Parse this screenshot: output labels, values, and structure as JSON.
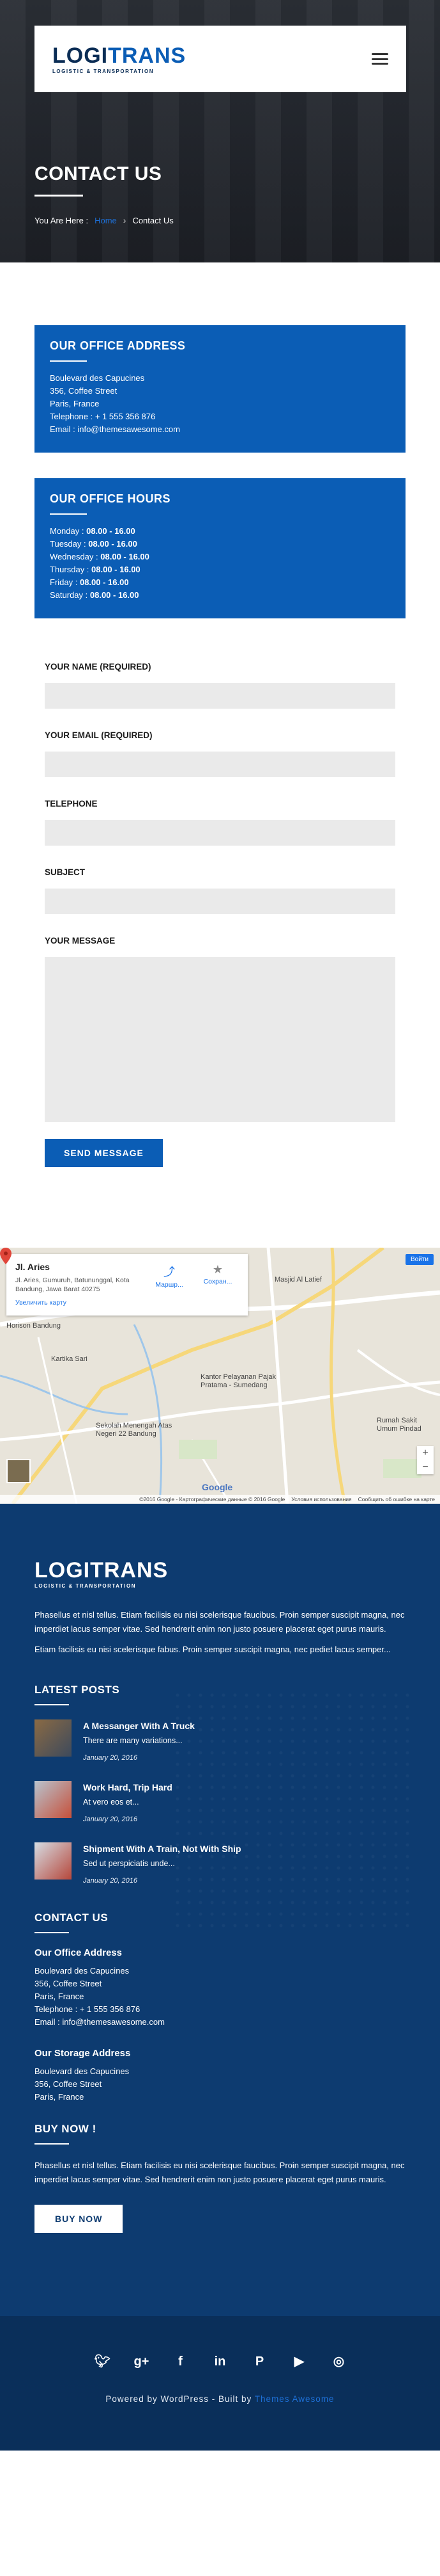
{
  "header": {
    "logo_main_a": "LOGI",
    "logo_main_b": "TRANS",
    "logo_sub": "LOGISTIC & TRANSPORTATION"
  },
  "hero": {
    "title": "CONTACT US",
    "breadcrumb_prefix": "You Are Here :",
    "breadcrumb_home": "Home",
    "breadcrumb_current": "Contact Us"
  },
  "office_address": {
    "title": "OUR OFFICE ADDRESS",
    "lines": [
      "Boulevard des Capucines",
      "356, Coffee Street",
      "Paris, France",
      "Telephone : + 1 555 356 876",
      "Email : info@themesawesome.com"
    ]
  },
  "office_hours": {
    "title": "OUR OFFICE HOURS",
    "days": [
      {
        "day": "Monday : ",
        "hours": "08.00 - 16.00"
      },
      {
        "day": "Tuesday : ",
        "hours": "08.00 - 16.00"
      },
      {
        "day": "Wednesday : ",
        "hours": "08.00 - 16.00"
      },
      {
        "day": "Thursday : ",
        "hours": "08.00 - 16.00"
      },
      {
        "day": "Friday : ",
        "hours": "08.00 - 16.00"
      },
      {
        "day": "Saturday : ",
        "hours": "08.00 - 16.00"
      }
    ]
  },
  "form": {
    "name_label": "YOUR NAME (REQUIRED)",
    "email_label": "YOUR EMAIL (REQUIRED)",
    "phone_label": "TELEPHONE",
    "subject_label": "SUBJECT",
    "message_label": "YOUR MESSAGE",
    "send_label": "SEND MESSAGE"
  },
  "map": {
    "place_name": "Jl. Aries",
    "place_addr": "Jl. Aries, Gumuruh, Batununggal, Kota Bandung, Jawa Barat 40275",
    "bigger_map": "Увеличить карту",
    "route_label": "Маршр...",
    "save_label": "Сохран...",
    "video_label": "Войти",
    "label_masjid": "Masjid Al Latief",
    "label_horison": "Horison Bandung",
    "label_kantor": "Kantor Pelayanan Pajak Pratama - Sumedang",
    "label_sekolah": "Sekolah Menengah Atas Negeri 22 Bandung",
    "label_rs": "Rumah Sakit Umum Pindad",
    "label_kartika": "Kartika Sari",
    "label_google": "Google",
    "footer_data": "©2016 Google - Картографические данные © 2016 Google",
    "footer_terms": "Условия использования",
    "footer_report": "Сообщить об ошибке на карте",
    "zoom_in": "+",
    "zoom_out": "−"
  },
  "footer": {
    "about_p1": "Phasellus et nisl tellus. Etiam facilisis eu nisi scelerisque faucibus. Proin semper suscipit magna, nec imperdiet lacus semper vitae. Sed hendrerit enim non justo posuere placerat eget purus mauris.",
    "about_p2": "Etiam facilisis eu nisi scelerisque fabus. Proin semper suscipit magna, nec pediet lacus semper...",
    "latest_posts_title": "LATEST POSTS",
    "posts": [
      {
        "title": "A Messanger With A Truck",
        "excerpt": "There are many variations...",
        "date": "January 20, 2016"
      },
      {
        "title": "Work Hard, Trip Hard",
        "excerpt": "At vero eos et...",
        "date": "January 20, 2016"
      },
      {
        "title": "Shipment With A Train, Not With Ship",
        "excerpt": "Sed ut perspiciatis unde...",
        "date": "January 20, 2016"
      }
    ],
    "contact_title": "CONTACT US",
    "office_sub": "Our Office Address",
    "office_lines": [
      "Boulevard des Capucines",
      "356, Coffee Street",
      "Paris, France",
      "Telephone : + 1 555 356 876",
      "Email : info@themesawesome.com"
    ],
    "storage_sub": "Our Storage Address",
    "storage_lines": [
      "Boulevard des Capucines",
      "356, Coffee Street",
      "Paris, France"
    ],
    "buy_title": "BUY NOW !",
    "buy_text": "Phasellus et nisl tellus. Etiam facilisis eu nisi scelerisque faucibus. Proin semper suscipit magna, nec imperdiet lacus semper vitae. Sed hendrerit enim non justo posuere placerat eget purus mauris.",
    "buy_button": "BUY NOW",
    "powered_prefix": "Powered by WordPress - Built by ",
    "powered_link": "Themes Awesome"
  },
  "icons": [
    "menu-icon",
    "chevron-right-icon",
    "directions-icon",
    "star-icon",
    "map-pin-icon",
    "twitter-icon",
    "google-plus-icon",
    "facebook-icon",
    "linkedin-icon",
    "pinterest-icon",
    "youtube-icon",
    "instagram-icon"
  ],
  "colors": {
    "brand_blue": "#0b5db5",
    "dark_navy": "#0d3b70",
    "link_blue": "#1d6fd6"
  }
}
